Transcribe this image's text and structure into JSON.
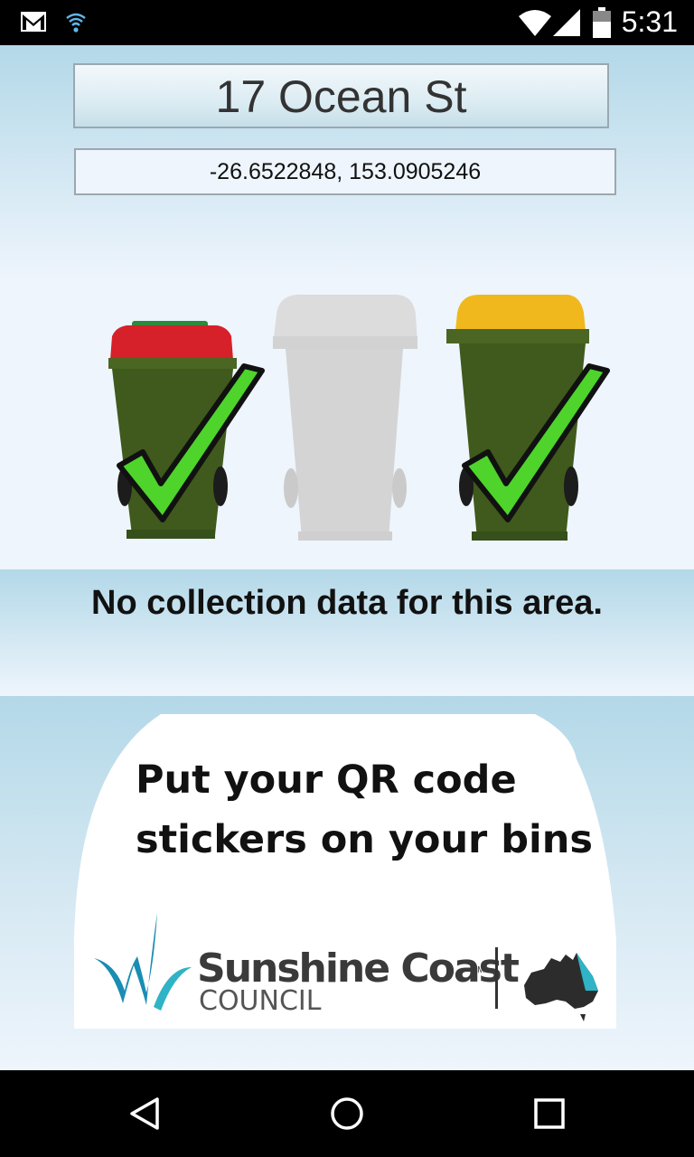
{
  "status_bar": {
    "time": "5:31",
    "icons": [
      "gmail-icon",
      "wifi-icon",
      "signal-icon",
      "battery-icon"
    ]
  },
  "address": {
    "street": "17 Ocean St",
    "coordinates": "-26.6522848, 153.0905246"
  },
  "bins": [
    {
      "lid_color": "red",
      "checked": true
    },
    {
      "lid_color": "grey",
      "checked": false
    },
    {
      "lid_color": "yellow",
      "checked": true
    }
  ],
  "collection_message": "No collection data for this area.",
  "promo": {
    "line1": "Put your QR code",
    "line2": "stickers on your bins",
    "logo_name": "Sunshine Coast",
    "logo_tm": "TM",
    "logo_sub": "COUNCIL"
  },
  "nav": [
    "back-icon",
    "home-icon",
    "recents-icon"
  ],
  "colors": {
    "bin_body": "#3f5a1c",
    "lid_red": "#d6202a",
    "lid_yellow": "#f0b81c",
    "check": "#4ed42b",
    "bg": "#eef5fc",
    "band": "#b3d8e8"
  }
}
